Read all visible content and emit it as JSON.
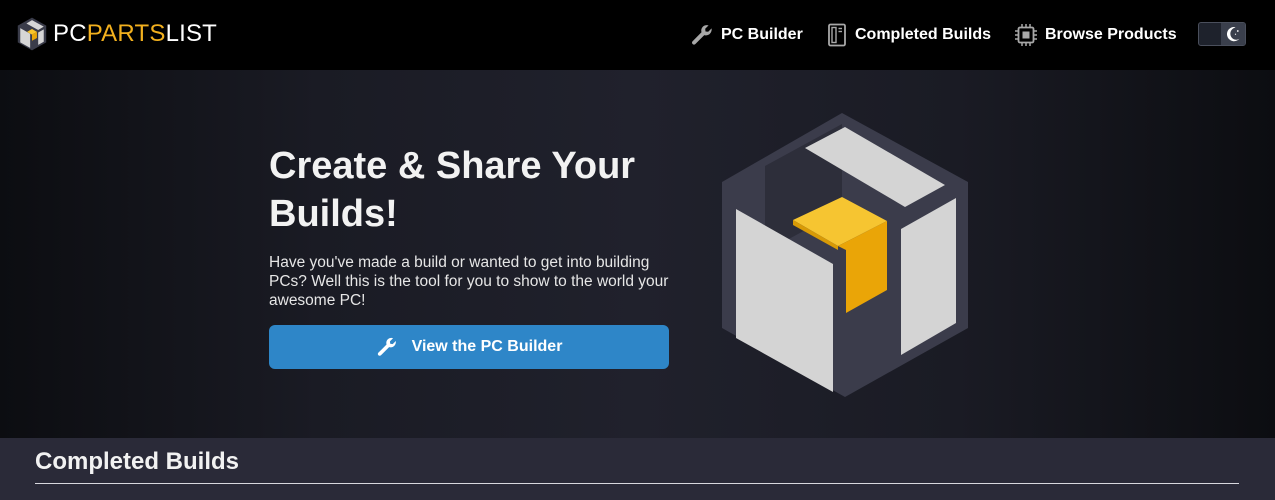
{
  "brand": {
    "pc": "PC",
    "parts": "PARTS",
    "list": "LIST",
    "logo_icon": "cube-logo-icon",
    "accent": "#f2b01e"
  },
  "nav": {
    "items": [
      {
        "label": "PC Builder",
        "icon": "wrench-icon"
      },
      {
        "label": "Completed Builds",
        "icon": "pc-case-icon"
      },
      {
        "label": "Browse Products",
        "icon": "cpu-chip-icon"
      }
    ],
    "theme_toggle_icon": "moon-icon",
    "theme_mode": "dark"
  },
  "hero": {
    "title": "Create & Share Your Builds!",
    "description": "Have you've made a build or wanted to get into building PCs? Well this is the tool for you to show to the world your awesome PC!",
    "cta_label": "View the PC Builder",
    "cta_icon": "wrench-icon",
    "cta_color": "#2e86c8",
    "illustration": "cube-logo-illustration"
  },
  "section": {
    "title": "Completed Builds"
  },
  "colors": {
    "header_bg": "#000000",
    "hero_bg": "#1d1e28",
    "section_bg": "#2a2a38"
  }
}
